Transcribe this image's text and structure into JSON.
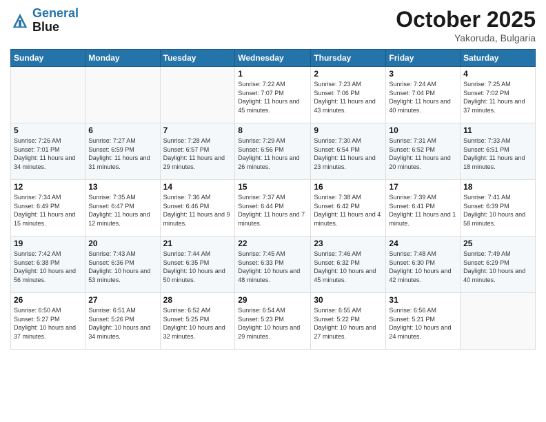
{
  "header": {
    "logo_line1": "General",
    "logo_line2": "Blue",
    "month": "October 2025",
    "location": "Yakoruda, Bulgaria"
  },
  "weekdays": [
    "Sunday",
    "Monday",
    "Tuesday",
    "Wednesday",
    "Thursday",
    "Friday",
    "Saturday"
  ],
  "weeks": [
    [
      {
        "day": "",
        "sunrise": "",
        "sunset": "",
        "daylight": ""
      },
      {
        "day": "",
        "sunrise": "",
        "sunset": "",
        "daylight": ""
      },
      {
        "day": "",
        "sunrise": "",
        "sunset": "",
        "daylight": ""
      },
      {
        "day": "1",
        "sunrise": "Sunrise: 7:22 AM",
        "sunset": "Sunset: 7:07 PM",
        "daylight": "Daylight: 11 hours and 45 minutes."
      },
      {
        "day": "2",
        "sunrise": "Sunrise: 7:23 AM",
        "sunset": "Sunset: 7:06 PM",
        "daylight": "Daylight: 11 hours and 43 minutes."
      },
      {
        "day": "3",
        "sunrise": "Sunrise: 7:24 AM",
        "sunset": "Sunset: 7:04 PM",
        "daylight": "Daylight: 11 hours and 40 minutes."
      },
      {
        "day": "4",
        "sunrise": "Sunrise: 7:25 AM",
        "sunset": "Sunset: 7:02 PM",
        "daylight": "Daylight: 11 hours and 37 minutes."
      }
    ],
    [
      {
        "day": "5",
        "sunrise": "Sunrise: 7:26 AM",
        "sunset": "Sunset: 7:01 PM",
        "daylight": "Daylight: 11 hours and 34 minutes."
      },
      {
        "day": "6",
        "sunrise": "Sunrise: 7:27 AM",
        "sunset": "Sunset: 6:59 PM",
        "daylight": "Daylight: 11 hours and 31 minutes."
      },
      {
        "day": "7",
        "sunrise": "Sunrise: 7:28 AM",
        "sunset": "Sunset: 6:57 PM",
        "daylight": "Daylight: 11 hours and 29 minutes."
      },
      {
        "day": "8",
        "sunrise": "Sunrise: 7:29 AM",
        "sunset": "Sunset: 6:56 PM",
        "daylight": "Daylight: 11 hours and 26 minutes."
      },
      {
        "day": "9",
        "sunrise": "Sunrise: 7:30 AM",
        "sunset": "Sunset: 6:54 PM",
        "daylight": "Daylight: 11 hours and 23 minutes."
      },
      {
        "day": "10",
        "sunrise": "Sunrise: 7:31 AM",
        "sunset": "Sunset: 6:52 PM",
        "daylight": "Daylight: 11 hours and 20 minutes."
      },
      {
        "day": "11",
        "sunrise": "Sunrise: 7:33 AM",
        "sunset": "Sunset: 6:51 PM",
        "daylight": "Daylight: 11 hours and 18 minutes."
      }
    ],
    [
      {
        "day": "12",
        "sunrise": "Sunrise: 7:34 AM",
        "sunset": "Sunset: 6:49 PM",
        "daylight": "Daylight: 11 hours and 15 minutes."
      },
      {
        "day": "13",
        "sunrise": "Sunrise: 7:35 AM",
        "sunset": "Sunset: 6:47 PM",
        "daylight": "Daylight: 11 hours and 12 minutes."
      },
      {
        "day": "14",
        "sunrise": "Sunrise: 7:36 AM",
        "sunset": "Sunset: 6:46 PM",
        "daylight": "Daylight: 11 hours and 9 minutes."
      },
      {
        "day": "15",
        "sunrise": "Sunrise: 7:37 AM",
        "sunset": "Sunset: 6:44 PM",
        "daylight": "Daylight: 11 hours and 7 minutes."
      },
      {
        "day": "16",
        "sunrise": "Sunrise: 7:38 AM",
        "sunset": "Sunset: 6:42 PM",
        "daylight": "Daylight: 11 hours and 4 minutes."
      },
      {
        "day": "17",
        "sunrise": "Sunrise: 7:39 AM",
        "sunset": "Sunset: 6:41 PM",
        "daylight": "Daylight: 11 hours and 1 minute."
      },
      {
        "day": "18",
        "sunrise": "Sunrise: 7:41 AM",
        "sunset": "Sunset: 6:39 PM",
        "daylight": "Daylight: 10 hours and 58 minutes."
      }
    ],
    [
      {
        "day": "19",
        "sunrise": "Sunrise: 7:42 AM",
        "sunset": "Sunset: 6:38 PM",
        "daylight": "Daylight: 10 hours and 56 minutes."
      },
      {
        "day": "20",
        "sunrise": "Sunrise: 7:43 AM",
        "sunset": "Sunset: 6:36 PM",
        "daylight": "Daylight: 10 hours and 53 minutes."
      },
      {
        "day": "21",
        "sunrise": "Sunrise: 7:44 AM",
        "sunset": "Sunset: 6:35 PM",
        "daylight": "Daylight: 10 hours and 50 minutes."
      },
      {
        "day": "22",
        "sunrise": "Sunrise: 7:45 AM",
        "sunset": "Sunset: 6:33 PM",
        "daylight": "Daylight: 10 hours and 48 minutes."
      },
      {
        "day": "23",
        "sunrise": "Sunrise: 7:46 AM",
        "sunset": "Sunset: 6:32 PM",
        "daylight": "Daylight: 10 hours and 45 minutes."
      },
      {
        "day": "24",
        "sunrise": "Sunrise: 7:48 AM",
        "sunset": "Sunset: 6:30 PM",
        "daylight": "Daylight: 10 hours and 42 minutes."
      },
      {
        "day": "25",
        "sunrise": "Sunrise: 7:49 AM",
        "sunset": "Sunset: 6:29 PM",
        "daylight": "Daylight: 10 hours and 40 minutes."
      }
    ],
    [
      {
        "day": "26",
        "sunrise": "Sunrise: 6:50 AM",
        "sunset": "Sunset: 5:27 PM",
        "daylight": "Daylight: 10 hours and 37 minutes."
      },
      {
        "day": "27",
        "sunrise": "Sunrise: 6:51 AM",
        "sunset": "Sunset: 5:26 PM",
        "daylight": "Daylight: 10 hours and 34 minutes."
      },
      {
        "day": "28",
        "sunrise": "Sunrise: 6:52 AM",
        "sunset": "Sunset: 5:25 PM",
        "daylight": "Daylight: 10 hours and 32 minutes."
      },
      {
        "day": "29",
        "sunrise": "Sunrise: 6:54 AM",
        "sunset": "Sunset: 5:23 PM",
        "daylight": "Daylight: 10 hours and 29 minutes."
      },
      {
        "day": "30",
        "sunrise": "Sunrise: 6:55 AM",
        "sunset": "Sunset: 5:22 PM",
        "daylight": "Daylight: 10 hours and 27 minutes."
      },
      {
        "day": "31",
        "sunrise": "Sunrise: 6:56 AM",
        "sunset": "Sunset: 5:21 PM",
        "daylight": "Daylight: 10 hours and 24 minutes."
      },
      {
        "day": "",
        "sunrise": "",
        "sunset": "",
        "daylight": ""
      }
    ]
  ]
}
